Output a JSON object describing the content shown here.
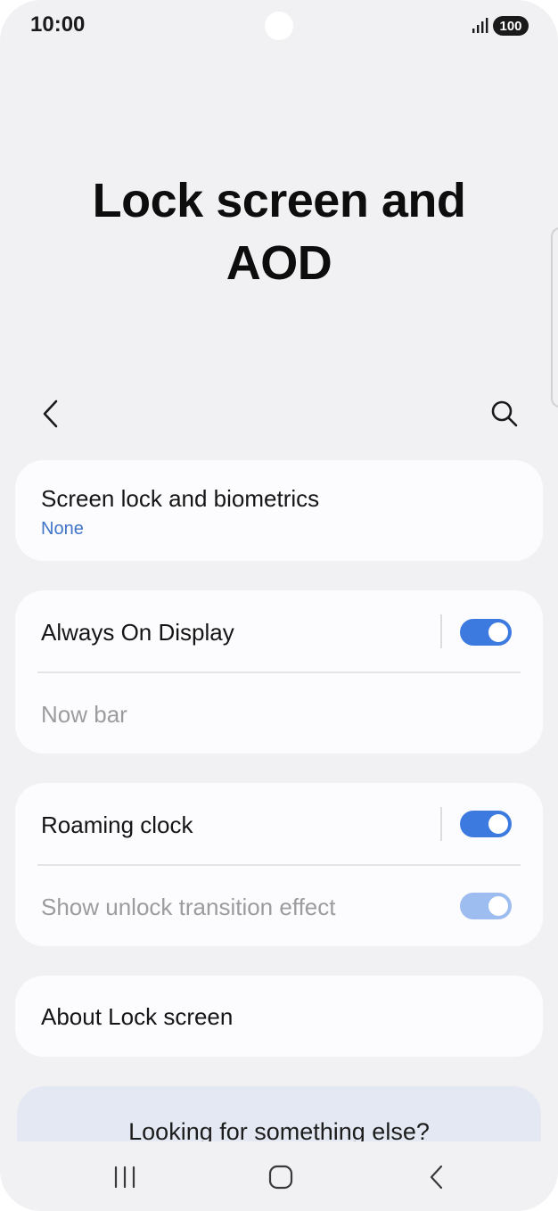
{
  "status_bar": {
    "time": "10:00",
    "battery": "100",
    "signal_icon": "signal-bars-icon"
  },
  "page": {
    "title_line1": "Lock screen and",
    "title_line2": "AOD"
  },
  "toolbar": {
    "back_icon": "chevron-left-icon",
    "search_icon": "search-icon"
  },
  "cards": {
    "screen_lock": {
      "label": "Screen lock and biometrics",
      "value": "None"
    },
    "aod": {
      "label": "Always On Display",
      "toggle_on": true,
      "now_bar_label": "Now bar"
    },
    "roaming": {
      "label": "Roaming clock",
      "toggle_on": true,
      "unlock_effect_label": "Show unlock transition effect",
      "unlock_effect_on": true
    },
    "about": {
      "label": "About Lock screen"
    }
  },
  "suggestions": {
    "title": "Looking for something else?"
  },
  "nav_bar": {
    "recents_icon": "recents-icon",
    "home_icon": "home-icon",
    "back_icon": "back-icon"
  },
  "colors": {
    "accent": "#3c7ae0",
    "accent_disabled": "#9dbcef",
    "link": "#3f74c9",
    "background": "#f1f1f3",
    "card": "#fcfcfe"
  }
}
